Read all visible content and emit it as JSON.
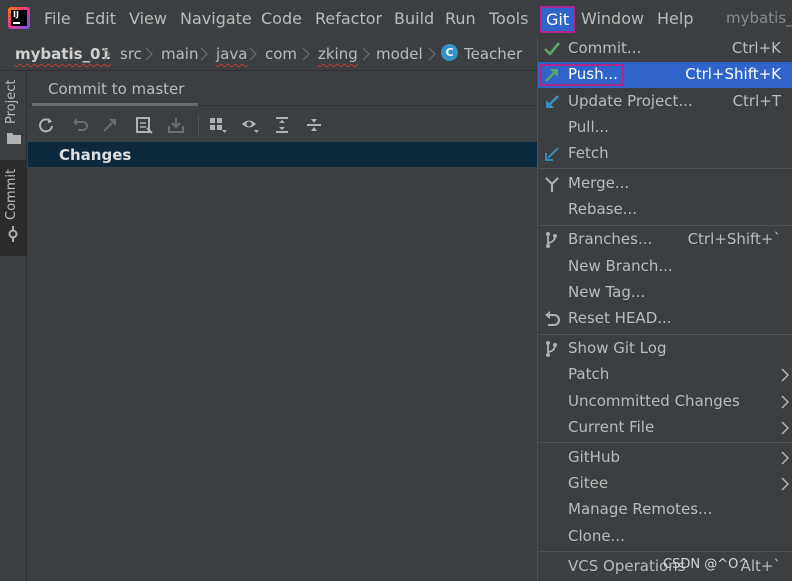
{
  "menubar": {
    "items": [
      "File",
      "Edit",
      "View",
      "Navigate",
      "Code",
      "Refactor",
      "Build",
      "Run",
      "Tools",
      "Git",
      "Window",
      "Help"
    ],
    "active": "Git",
    "window_title": "mybatis_("
  },
  "breadcrumb": {
    "items": [
      "mybatis_01",
      "src",
      "main",
      "java",
      "com",
      "zking",
      "model",
      "Teacher"
    ],
    "class_icon_letter": "C"
  },
  "tool_strip": {
    "project_label": "Project",
    "commit_label": "Commit"
  },
  "commit_panel": {
    "tab_label": "Commit to master",
    "changes_label": "Changes",
    "toolbar_icons": [
      "refresh-icon",
      "rollback-icon",
      "update-icon",
      "diff-icon",
      "shelve-icon",
      "group-by-icon",
      "eye-icon",
      "expand-all-icon",
      "collapse-all-icon"
    ]
  },
  "git_menu": {
    "items": [
      {
        "label": "Commit...",
        "shortcut": "Ctrl+K",
        "icon": "check-icon"
      },
      {
        "label": "Push...",
        "shortcut": "Ctrl+Shift+K",
        "icon": "push-arrow-icon",
        "selected": true
      },
      {
        "label": "Update Project...",
        "shortcut": "Ctrl+T",
        "icon": "update-arrow-icon"
      },
      {
        "label": "Pull...",
        "shortcut": "",
        "icon": ""
      },
      {
        "label": "Fetch",
        "shortcut": "",
        "icon": "fetch-arrow-icon"
      },
      {
        "label": "Merge...",
        "shortcut": "",
        "icon": "merge-icon"
      },
      {
        "label": "Rebase...",
        "shortcut": "",
        "icon": ""
      },
      {
        "label": "Branches...",
        "shortcut": "Ctrl+Shift+`",
        "icon": "branch-icon"
      },
      {
        "label": "New Branch...",
        "shortcut": "",
        "icon": ""
      },
      {
        "label": "New Tag...",
        "shortcut": "",
        "icon": ""
      },
      {
        "label": "Reset HEAD...",
        "shortcut": "",
        "icon": "reset-icon"
      },
      {
        "label": "Show Git Log",
        "shortcut": "",
        "icon": "git-log-icon"
      },
      {
        "label": "Patch",
        "shortcut": "",
        "icon": "",
        "submenu": true
      },
      {
        "label": "Uncommitted Changes",
        "shortcut": "",
        "icon": "",
        "submenu": true
      },
      {
        "label": "Current File",
        "shortcut": "",
        "icon": "",
        "submenu": true
      },
      {
        "label": "GitHub",
        "shortcut": "",
        "icon": "",
        "submenu": true
      },
      {
        "label": "Gitee",
        "shortcut": "",
        "icon": "",
        "submenu": true
      },
      {
        "label": "Manage Remotes...",
        "shortcut": "",
        "icon": ""
      },
      {
        "label": "Clone...",
        "shortcut": "",
        "icon": ""
      },
      {
        "label": "VCS Operations",
        "shortcut": "Alt+`",
        "icon": ""
      }
    ]
  },
  "colors": {
    "background": "#3c3f41",
    "selection": "#2f65ca",
    "highlight_border": "#b1268b",
    "changes_row": "#0d293e"
  },
  "watermark": "CSDN @^O^"
}
